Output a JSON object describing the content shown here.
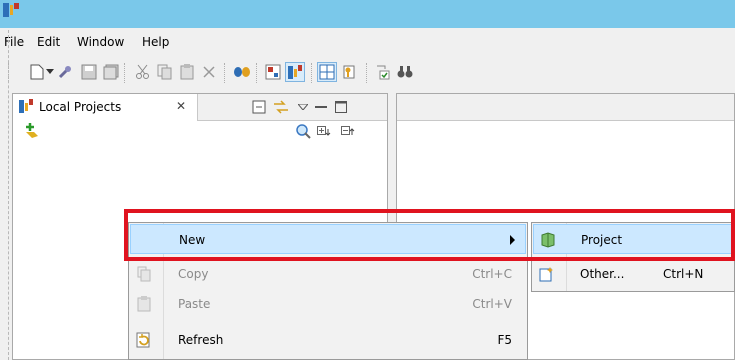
{
  "menubar": {
    "items": [
      "File",
      "Edit",
      "Window",
      "Help"
    ]
  },
  "toolbar": {
    "icons": [
      "new-file-icon",
      "new-wizard-dropdown-icon",
      "wrench-icon",
      "save-icon",
      "save-all-icon",
      "cut-icon",
      "copy-icon",
      "paste-icon",
      "delete-icon",
      "debug-icon",
      "perspective-icon",
      "local-projects-icon",
      "layout-icon",
      "key-icon",
      "checklist-icon",
      "binoculars-icon"
    ]
  },
  "view": {
    "tab_label": "Local Projects",
    "close_glyph": "✕",
    "header_icons": [
      "collapse-all-icon",
      "link-with-editor-icon",
      "view-menu-icon",
      "minimize-icon",
      "maximize-icon"
    ],
    "toolbar_icons": [
      "add-project-icon",
      "search-icon",
      "expand-all-icon",
      "collapse-all-icon"
    ]
  },
  "context_menu": {
    "items": [
      {
        "label": "New",
        "shortcut": "",
        "enabled": true,
        "highlighted": true,
        "has_submenu": true
      },
      {
        "label": "Copy",
        "shortcut": "Ctrl+C",
        "enabled": false
      },
      {
        "label": "Paste",
        "shortcut": "Ctrl+V",
        "enabled": false
      },
      {
        "label": "Refresh",
        "shortcut": "F5",
        "enabled": true
      }
    ]
  },
  "submenu": {
    "items": [
      {
        "label": "Project",
        "shortcut": "",
        "highlighted": true
      },
      {
        "label": "Other...",
        "shortcut": "Ctrl+N",
        "highlighted": false
      }
    ]
  },
  "colors": {
    "title_bar": "#7ac8ea",
    "highlight": "#cce8ff",
    "annotation_red": "#e0131f"
  }
}
